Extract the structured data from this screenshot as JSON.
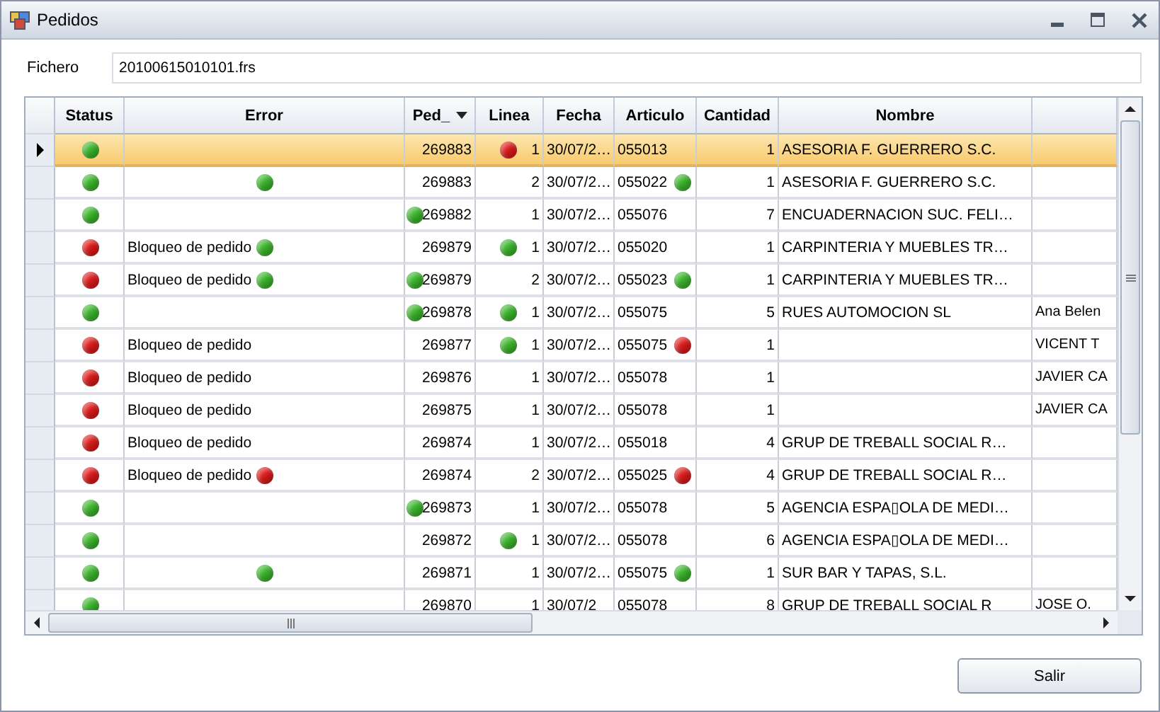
{
  "window": {
    "title": "Pedidos"
  },
  "fichero": {
    "label": "Fichero",
    "value": "20100615010101.frs"
  },
  "table": {
    "columns": [
      {
        "label": "Status",
        "sorted": false
      },
      {
        "label": "Error",
        "sorted": false
      },
      {
        "label": "Ped_",
        "sorted": true
      },
      {
        "label": "Linea",
        "sorted": false
      },
      {
        "label": "Fecha",
        "sorted": false
      },
      {
        "label": "Articulo",
        "sorted": false
      },
      {
        "label": "Cantidad",
        "sorted": false
      },
      {
        "label": "Nombre",
        "sorted": false
      },
      {
        "sorted": false
      }
    ],
    "rows": [
      {
        "selected": true,
        "cells": [
          {
            "color": "#3cb82c"
          },
          {},
          {
            "text": "269883"
          },
          {
            "text": "1",
            "color": "#e01a1a"
          },
          {
            "text": "30/07/2…"
          },
          {
            "text": "055013"
          },
          {
            "text": "1"
          },
          {
            "text": "ASESORIA F. GUERRERO S.C."
          },
          {}
        ]
      },
      {
        "selected": false,
        "cells": [
          {
            "color": "#3cb82c"
          },
          {
            "color": "#3cb82c"
          },
          {
            "text": "269883"
          },
          {
            "text": "2"
          },
          {
            "text": "30/07/2…"
          },
          {
            "text": "055022",
            "color": "#3cb82c"
          },
          {
            "text": "1"
          },
          {
            "text": "ASESORIA F. GUERRERO S.C."
          },
          {}
        ]
      },
      {
        "selected": false,
        "cells": [
          {
            "color": "#3cb82c"
          },
          {},
          {
            "text": "269882",
            "color": "#3cb82c"
          },
          {
            "text": "1"
          },
          {
            "text": "30/07/2…"
          },
          {
            "text": "055076"
          },
          {
            "text": "7"
          },
          {
            "text": "ENCUADERNACION SUC. FELI…"
          },
          {}
        ]
      },
      {
        "selected": false,
        "cells": [
          {
            "color": "#e01a1a"
          },
          {
            "text": "Bloqueo de pedido",
            "color": "#3cb82c"
          },
          {
            "text": "269879"
          },
          {
            "text": "1",
            "color": "#3cb82c"
          },
          {
            "text": "30/07/2…"
          },
          {
            "text": "055020"
          },
          {
            "text": "1"
          },
          {
            "text": "CARPINTERIA Y MUEBLES TR…"
          },
          {}
        ]
      },
      {
        "selected": false,
        "cells": [
          {
            "color": "#e01a1a"
          },
          {
            "text": "Bloqueo de pedido",
            "color": "#3cb82c"
          },
          {
            "text": "269879",
            "color": "#3cb82c"
          },
          {
            "text": "2"
          },
          {
            "text": "30/07/2…"
          },
          {
            "text": "055023",
            "color": "#3cb82c"
          },
          {
            "text": "1"
          },
          {
            "text": "CARPINTERIA Y MUEBLES TR…"
          },
          {}
        ]
      },
      {
        "selected": false,
        "cells": [
          {
            "color": "#3cb82c"
          },
          {},
          {
            "text": "269878",
            "color": "#3cb82c"
          },
          {
            "text": "1",
            "color": "#3cb82c"
          },
          {
            "text": "30/07/2…"
          },
          {
            "text": "055075"
          },
          {
            "text": "5"
          },
          {
            "text": "RUES AUTOMOCION SL"
          },
          {
            "text": "Ana Belen"
          }
        ]
      },
      {
        "selected": false,
        "cells": [
          {
            "color": "#e01a1a"
          },
          {
            "text": "Bloqueo de pedido"
          },
          {
            "text": "269877"
          },
          {
            "text": "1",
            "color": "#3cb82c"
          },
          {
            "text": "30/07/2…"
          },
          {
            "text": "055075",
            "color": "#e01a1a"
          },
          {
            "text": "1"
          },
          {},
          {
            "text": "VICENT T"
          }
        ]
      },
      {
        "selected": false,
        "cells": [
          {
            "color": "#e01a1a"
          },
          {
            "text": "Bloqueo de pedido"
          },
          {
            "text": "269876"
          },
          {
            "text": "1"
          },
          {
            "text": "30/07/2…"
          },
          {
            "text": "055078"
          },
          {
            "text": "1"
          },
          {},
          {
            "text": "JAVIER CA"
          }
        ]
      },
      {
        "selected": false,
        "cells": [
          {
            "color": "#e01a1a"
          },
          {
            "text": "Bloqueo de pedido"
          },
          {
            "text": "269875"
          },
          {
            "text": "1"
          },
          {
            "text": "30/07/2…"
          },
          {
            "text": "055078"
          },
          {
            "text": "1"
          },
          {},
          {
            "text": "JAVIER CA"
          }
        ]
      },
      {
        "selected": false,
        "cells": [
          {
            "color": "#e01a1a"
          },
          {
            "text": "Bloqueo de pedido"
          },
          {
            "text": "269874"
          },
          {
            "text": "1"
          },
          {
            "text": "30/07/2…"
          },
          {
            "text": "055018"
          },
          {
            "text": "4"
          },
          {
            "text": "GRUP DE TREBALL SOCIAL R…"
          },
          {}
        ]
      },
      {
        "selected": false,
        "cells": [
          {
            "color": "#e01a1a"
          },
          {
            "text": "Bloqueo de pedido",
            "color": "#e01a1a"
          },
          {
            "text": "269874"
          },
          {
            "text": "2"
          },
          {
            "text": "30/07/2…"
          },
          {
            "text": "055025",
            "color": "#e01a1a"
          },
          {
            "text": "4"
          },
          {
            "text": "GRUP DE TREBALL SOCIAL R…"
          },
          {}
        ]
      },
      {
        "selected": false,
        "cells": [
          {
            "color": "#3cb82c"
          },
          {},
          {
            "text": "269873",
            "color": "#3cb82c"
          },
          {
            "text": "1"
          },
          {
            "text": "30/07/2…"
          },
          {
            "text": "055078"
          },
          {
            "text": "5"
          },
          {
            "text": "AGENCIA ESPA▯OLA DE MEDI…"
          },
          {}
        ]
      },
      {
        "selected": false,
        "cells": [
          {
            "color": "#3cb82c"
          },
          {},
          {
            "text": "269872"
          },
          {
            "text": "1",
            "color": "#3cb82c"
          },
          {
            "text": "30/07/2…"
          },
          {
            "text": "055078"
          },
          {
            "text": "6"
          },
          {
            "text": "AGENCIA ESPA▯OLA DE MEDI…"
          },
          {}
        ]
      },
      {
        "selected": false,
        "cells": [
          {
            "color": "#3cb82c"
          },
          {
            "color": "#3cb82c"
          },
          {
            "text": "269871"
          },
          {
            "text": "1"
          },
          {
            "text": "30/07/2…"
          },
          {
            "text": "055075",
            "color": "#3cb82c"
          },
          {
            "text": "1"
          },
          {
            "text": "SUR BAR Y TAPAS, S.L."
          },
          {}
        ]
      },
      {
        "selected": false,
        "cells": [
          {
            "color": "#3cb82c"
          },
          {},
          {
            "text": "269870"
          },
          {
            "text": "1"
          },
          {
            "text": "30/07/2"
          },
          {
            "text": "055078"
          },
          {
            "text": "8"
          },
          {
            "text": "GRUP DE TREBALL SOCIAL R"
          },
          {
            "text": "JOSE O."
          }
        ]
      }
    ]
  },
  "buttons": [
    {
      "label": "Salir"
    }
  ]
}
